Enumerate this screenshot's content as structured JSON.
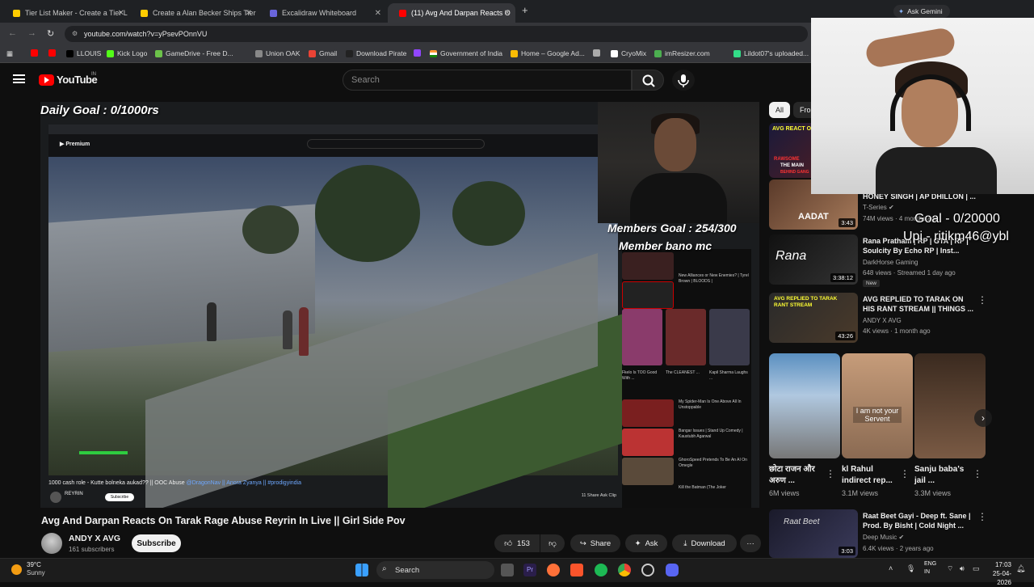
{
  "browser": {
    "tabs": [
      {
        "title": "Tier List Maker - Create a Tier L",
        "color": "#ffcc00"
      },
      {
        "title": "Create a Alan Becker Ships Tier",
        "color": "#ffcc00"
      },
      {
        "title": "Excalidraw Whiteboard",
        "color": "#6965db"
      },
      {
        "title": "(11) Avg And Darpan Reacts O",
        "color": "#ff0000"
      }
    ],
    "ask_gemini": "Ask Gemini",
    "url": "youtube.com/watch?v=yPsevPOnnVU",
    "bookmarks": [
      "LLOUIS",
      "Kick Logo",
      "GameDrive - Free D...",
      "Union OAK",
      "Gmail",
      "Download Pirate",
      "Government of India",
      "Home – Google Ad...",
      "CryoMix",
      "imResizer.com",
      "Lildot07's uploaded..."
    ]
  },
  "youtube": {
    "logo": "YouTube",
    "region": "IN",
    "search_placeholder": "Search"
  },
  "video": {
    "overlay_daily_goal": "Daily Goal : 0/1000rs",
    "overlay_members_goal": "Members Goal : 254/300",
    "overlay_member_bano": "Member bano mc",
    "inner_title": "1000 cash role - Kutte bolneka aukad?? || OOC Abuse",
    "inner_links": "@DragonNav || Anora Zyanya || #prodigyindia",
    "inner_channel": "REYRIN",
    "inner_sub": "Subscribe",
    "inner_pills": "11   Share   Ask   Clip",
    "inner_sidebar": [
      "New Alliances or New Enemies? | Tyrel Brown | BLOODS |",
      "Fkelo Is TOO Good With ...",
      "The CLEANEST ...",
      "Kapil Sharma Laughs ...",
      "My Spider-Man Is One Above All In Unstoppable",
      "Bangar Issues | Stand Up Comedy | Kaustubh Agarwal",
      "GhoroSpeed Pretends To Be An AI On Omegle",
      "Kill the Batman (The Joker"
    ],
    "title": "Avg And Darpan Reacts On Tarak Rage Abuse Reyrin In Live || Girl Side Pov",
    "channel": "ANDY X AVG",
    "subscribers": "161 subscribers",
    "subscribe": "Subscribe",
    "likes": "153",
    "share": "Share",
    "ask": "Ask",
    "download": "Download",
    "more": "···"
  },
  "sidebar": {
    "chips": [
      "All",
      "Fro"
    ],
    "recommendations": [
      {
        "title": "HONEY SINGH | AP DHILLON | ...",
        "channel": "T-Series",
        "meta": "74M views · 4 months ago",
        "duration": "3:43",
        "verified": true
      },
      {
        "title": "Rana Pratham | RP | GTA | RP | Soulcity By Echo RP | Inst...",
        "channel": "DarkHorse Gaming",
        "meta": "648 views · Streamed 1 day ago",
        "duration": "3:38:12",
        "badge": "New"
      },
      {
        "title": "AVG REPLIED TO TARAK ON HIS RANT STREAM || THINGS ...",
        "channel": "ANDY X AVG",
        "meta": "4K views · 1 month ago",
        "duration": "43:26"
      },
      {
        "title": "Raat Beet Gayi - Deep ft. Sane | Prod. By Bisht | Cold Night ...",
        "channel": "Deep Music",
        "meta": "6.4K views · 2 years ago",
        "duration": "3:03",
        "verified": true
      }
    ],
    "thumb_labels": {
      "top_thumb": "AVG REACT ON",
      "rawsome": "RAWSOME",
      "the_main": "THE MAIN",
      "behind": "BEHIND GANG",
      "aadat": "AADAT",
      "avg_replied": "AVG REPLIED TO TARAK RANT STREAM"
    },
    "shorts": [
      {
        "title": "छोटा राजन और अरुण ...",
        "views": "6M views"
      },
      {
        "title": "kl Rahul indirect rep...",
        "views": "3.1M views",
        "overlay": "I am not your Servent"
      },
      {
        "title": "Sanju baba's jail ...",
        "views": "3.3M views"
      }
    ]
  },
  "stream_overlay": {
    "goal": "Goal - 0/20000",
    "upi": "Upi - ritikm46@ybl"
  },
  "taskbar": {
    "temp": "39°C",
    "weather": "Sunny",
    "search": "Search",
    "lang1": "ENG",
    "lang2": "IN",
    "time": "17:03",
    "date": "25-04-2026"
  }
}
